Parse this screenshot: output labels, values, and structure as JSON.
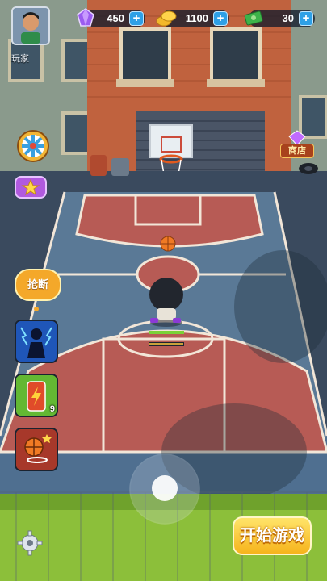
{
  "player": {
    "name": "玩家"
  },
  "currencies": {
    "gems": {
      "value": "450",
      "icon": "gem-icon"
    },
    "coins": {
      "value": "1100",
      "icon": "coin-icon"
    },
    "cash": {
      "value": "30",
      "icon": "cash-icon"
    },
    "plus_symbol": "+"
  },
  "shop": {
    "label": "商店"
  },
  "skills": {
    "steal_label": "抢断",
    "energy_count": "9"
  },
  "start_button": {
    "label": "开始游戏"
  },
  "colors": {
    "court_red": "#b75b55",
    "court_blue": "#4f6f90",
    "button_yellow": "#f6c52a",
    "plus_blue": "#2ea0e6"
  }
}
